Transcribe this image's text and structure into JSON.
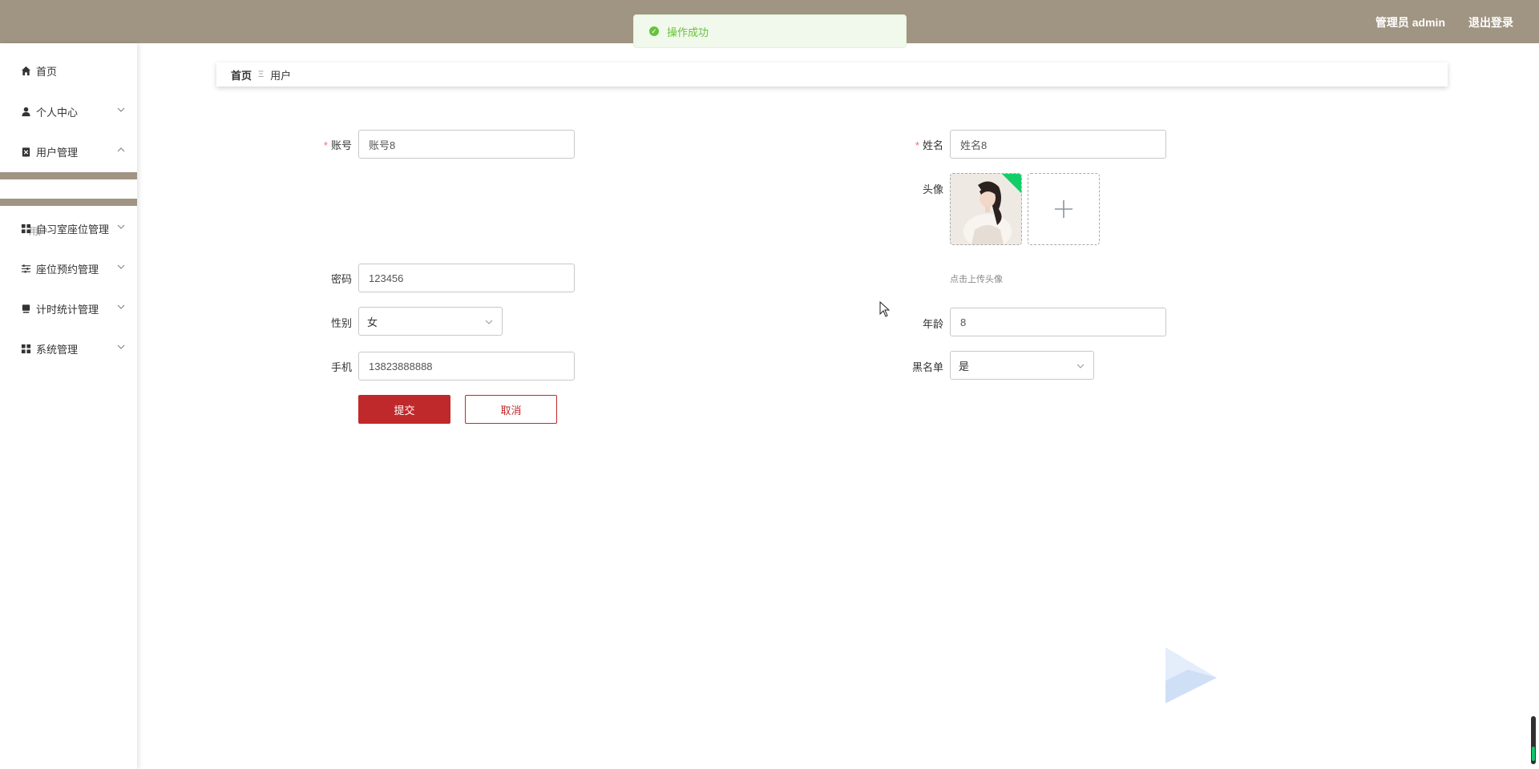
{
  "header": {
    "admin_label": "管理员 admin",
    "logout_label": "退出登录",
    "bg_color": "#a09482"
  },
  "toast": {
    "message": "操作成功",
    "icon": "check-circle-icon",
    "color": "#67c23a"
  },
  "sidebar": {
    "items": [
      {
        "label": "首页",
        "icon": "home-icon",
        "expandable": false
      },
      {
        "label": "个人中心",
        "icon": "user-icon",
        "expandable": true
      },
      {
        "label": "用户管理",
        "icon": "clipboard-icon",
        "expandable": true,
        "expanded": true
      },
      {
        "label": "自习室座位管理",
        "icon": "grid-icon",
        "expandable": true
      },
      {
        "label": "座位预约管理",
        "icon": "sliders-icon",
        "expandable": true
      },
      {
        "label": "计时统计管理",
        "icon": "monitor-icon",
        "expandable": true
      },
      {
        "label": "系统管理",
        "icon": "grid-icon",
        "expandable": true
      }
    ],
    "submenu": {
      "label": "用户"
    }
  },
  "breadcrumb": {
    "home": "首页",
    "separator": "Ξ",
    "current": "用户"
  },
  "form": {
    "account": {
      "label": "账号",
      "value": "账号8",
      "required": true
    },
    "name": {
      "label": "姓名",
      "value": "姓名8",
      "required": true
    },
    "avatar": {
      "label": "头像",
      "upload_tip": "点击上传头像"
    },
    "password": {
      "label": "密码",
      "value": "123456"
    },
    "gender": {
      "label": "性别",
      "value": "女"
    },
    "age": {
      "label": "年龄",
      "value": "8"
    },
    "phone": {
      "label": "手机",
      "value": "13823888888"
    },
    "blacklist": {
      "label": "黑名单",
      "value": "是"
    },
    "submit_label": "提交",
    "cancel_label": "取消",
    "accent_color": "#c0292b"
  }
}
